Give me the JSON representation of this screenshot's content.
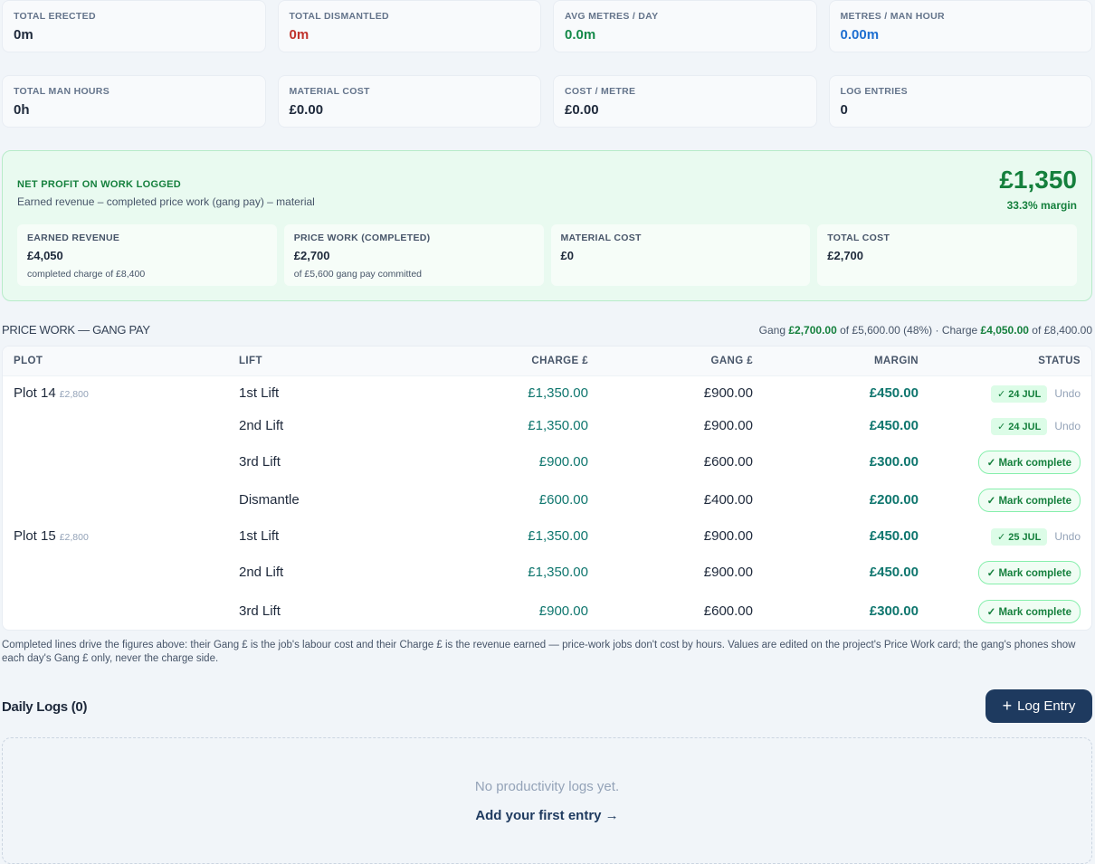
{
  "stats_row1": [
    {
      "label": "TOTAL ERECTED",
      "value": "0m"
    },
    {
      "label": "TOTAL DISMANTLED",
      "value": "0m"
    },
    {
      "label": "AVG METRES / DAY",
      "value": "0.0m"
    },
    {
      "label": "METRES / MAN HOUR",
      "value": "0.00m"
    }
  ],
  "stats_row2": [
    {
      "label": "TOTAL MAN HOURS",
      "value": "0h"
    },
    {
      "label": "MATERIAL COST",
      "value": "£0.00"
    },
    {
      "label": "COST / METRE",
      "value": "£0.00"
    },
    {
      "label": "LOG ENTRIES",
      "value": "0"
    }
  ],
  "colors": {
    "profit_green": "#15803d",
    "dismantled_red": "#c0322b",
    "avg_green": "#158a4a",
    "mph_blue": "#1f6fd1",
    "charge_teal": "#0f766e",
    "button_navy": "#1e3a5f"
  },
  "profit": {
    "title": "NET PROFIT ON WORK LOGGED",
    "subtitle": "Earned revenue – completed price work (gang pay) – material",
    "amount": "£1,350",
    "margin": "33.3% margin",
    "boxes": [
      {
        "label": "EARNED REVENUE",
        "value": "£4,050",
        "sub": "completed charge of £8,400"
      },
      {
        "label": "PRICE WORK (COMPLETED)",
        "value": "£2,700",
        "sub": "of £5,600 gang pay committed"
      },
      {
        "label": "MATERIAL COST",
        "value": "£0",
        "sub": ""
      },
      {
        "label": "TOTAL COST",
        "value": "£2,700",
        "sub": ""
      }
    ]
  },
  "price_work": {
    "title": "PRICE WORK — GANG PAY",
    "summary": {
      "gang_prefix": "Gang",
      "gang_value": "£2,700.00",
      "gang_suffix": "of £5,600.00 (48%) · Charge",
      "charge_value": "£4,050.00",
      "charge_suffix": "of £8,400.00"
    },
    "columns": [
      "PLOT",
      "LIFT",
      "CHARGE £",
      "GANG £",
      "MARGIN",
      "STATUS"
    ],
    "mark_complete_label": "✓ Mark complete",
    "undo_label": "Undo",
    "rows": [
      {
        "plot": "Plot 14",
        "plot_value": "£2,800",
        "lift": "1st Lift",
        "charge": "£1,350.00",
        "gang": "£900.00",
        "margin": "£450.00",
        "completed": "✓ 24 JUL"
      },
      {
        "plot": "",
        "plot_value": "",
        "lift": "2nd Lift",
        "charge": "£1,350.00",
        "gang": "£900.00",
        "margin": "£450.00",
        "completed": "✓ 24 JUL"
      },
      {
        "plot": "",
        "plot_value": "",
        "lift": "3rd Lift",
        "charge": "£900.00",
        "gang": "£600.00",
        "margin": "£300.00",
        "completed": ""
      },
      {
        "plot": "",
        "plot_value": "",
        "lift": "Dismantle",
        "charge": "£600.00",
        "gang": "£400.00",
        "margin": "£200.00",
        "completed": ""
      },
      {
        "plot": "Plot 15",
        "plot_value": "£2,800",
        "lift": "1st Lift",
        "charge": "£1,350.00",
        "gang": "£900.00",
        "margin": "£450.00",
        "completed": "✓ 25 JUL"
      },
      {
        "plot": "",
        "plot_value": "",
        "lift": "2nd Lift",
        "charge": "£1,350.00",
        "gang": "£900.00",
        "margin": "£450.00",
        "completed": ""
      },
      {
        "plot": "",
        "plot_value": "",
        "lift": "3rd Lift",
        "charge": "£900.00",
        "gang": "£600.00",
        "margin": "£300.00",
        "completed": ""
      }
    ]
  },
  "note": "Completed lines drive the figures above: their Gang £ is the job's labour cost and their Charge £ is the revenue earned — price-work jobs don't cost by hours. Values are edited on the project's Price Work card; the gang's phones show each day's Gang £ only, never the charge side.",
  "daily_logs": {
    "title": "Daily Logs (0)",
    "button_label": "Log Entry",
    "button_icon": "plus-icon",
    "empty_message": "No productivity logs yet.",
    "empty_link": "Add your first entry →"
  }
}
